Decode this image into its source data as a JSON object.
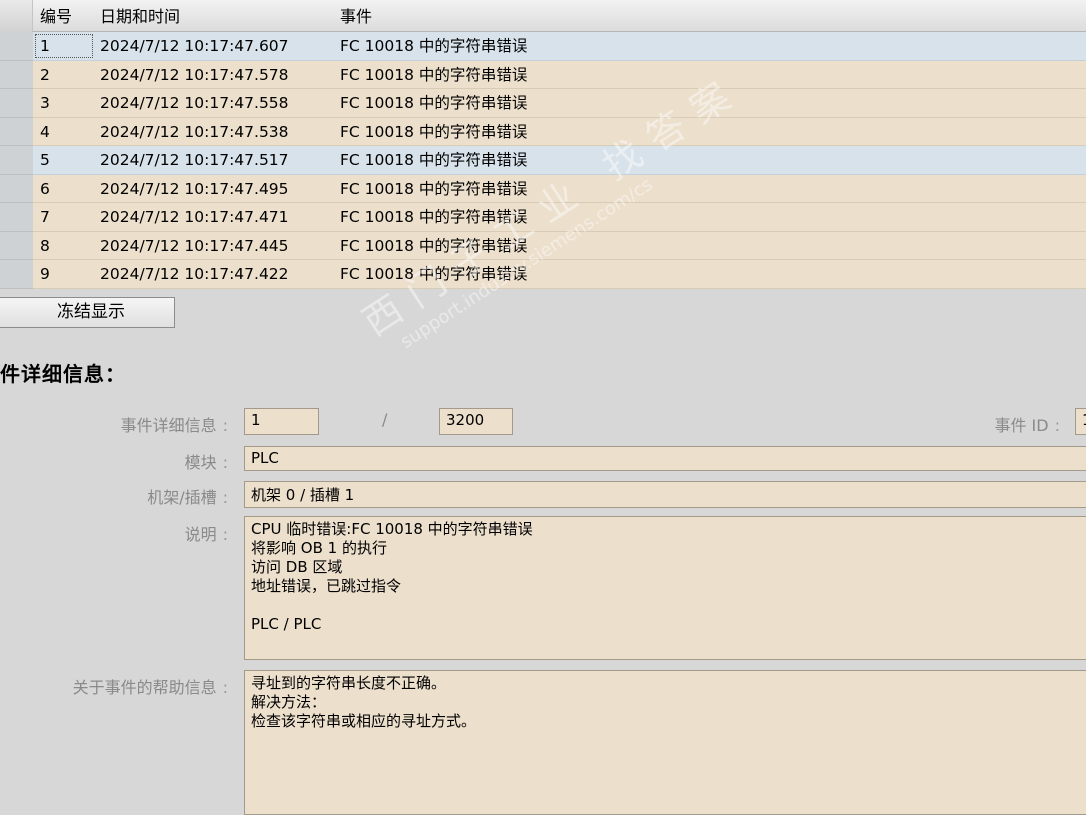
{
  "table": {
    "headers": {
      "num": "编号",
      "datetime": "日期和时间",
      "event": "事件"
    },
    "rows": [
      {
        "num": "1",
        "datetime": "2024/7/12 10:17:47.607",
        "event": "FC 10018 中的字符串错误"
      },
      {
        "num": "2",
        "datetime": "2024/7/12 10:17:47.578",
        "event": "FC 10018 中的字符串错误"
      },
      {
        "num": "3",
        "datetime": "2024/7/12 10:17:47.558",
        "event": "FC 10018 中的字符串错误"
      },
      {
        "num": "4",
        "datetime": "2024/7/12 10:17:47.538",
        "event": "FC 10018 中的字符串错误"
      },
      {
        "num": "5",
        "datetime": "2024/7/12 10:17:47.517",
        "event": "FC 10018 中的字符串错误"
      },
      {
        "num": "6",
        "datetime": "2024/7/12 10:17:47.495",
        "event": "FC 10018 中的字符串错误"
      },
      {
        "num": "7",
        "datetime": "2024/7/12 10:17:47.471",
        "event": "FC 10018 中的字符串错误"
      },
      {
        "num": "8",
        "datetime": "2024/7/12 10:17:47.445",
        "event": "FC 10018 中的字符串错误"
      },
      {
        "num": "9",
        "datetime": "2024/7/12 10:17:47.422",
        "event": "FC 10018 中的字符串错误"
      }
    ]
  },
  "freeze_button": {
    "label": "冻结显示"
  },
  "details": {
    "title": "件详细信息：",
    "event_details_label": "事件详细信息",
    "event_index": "1",
    "separator": "/",
    "event_total": "3200",
    "event_id_label": "事件 ID",
    "event_id_value": "1",
    "module_label": "模块",
    "module_value": "PLC",
    "rack_slot_label": "机架/插槽",
    "rack_slot_value": "机架 0 / 插槽 1",
    "description_label": "说明",
    "description_lines": [
      "CPU 临时错误:FC 10018 中的字符串错误",
      "将影响 OB 1 的执行",
      "访问 DB 区域",
      "地址错误，已跳过指令",
      "",
      " PLC / PLC"
    ],
    "help_label": "关于事件的帮助信息",
    "help_lines": [
      "寻址到的字符串长度不正确。",
      "解决方法：",
      "检查该字符串或相应的寻址方式。"
    ]
  },
  "watermark": {
    "line1": "西门子工业 找答案",
    "line2": "support.industry.siemens.com/cs"
  }
}
